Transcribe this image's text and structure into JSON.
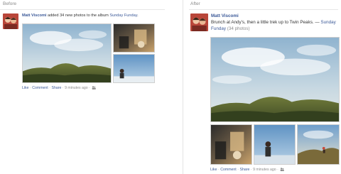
{
  "before": {
    "label": "Before",
    "actor": "Matt Viscomi",
    "story_text": " added 34 new photos to the album ",
    "album": "Sunday Funday",
    "story_end": ".",
    "actions": {
      "like": "Like",
      "comment": "Comment",
      "share": "Share",
      "time": "9 minutes ago",
      "separator": "·"
    }
  },
  "after": {
    "label": "After",
    "actor": "Matt Viscomi",
    "caption": "Brunch at Andy's, then a little trek up to Twin Peaks.",
    "dash": " — ",
    "album": "Sunday Funday",
    "count": "(34 photos)",
    "actions": {
      "like": "Like",
      "comment": "Comment",
      "share": "Share",
      "time": "9 minutes ago",
      "separator": "·"
    }
  },
  "icons": {
    "audience": "people-icon",
    "avatar": "profile-photo"
  },
  "colors": {
    "link": "#3b5998",
    "muted": "#8a8a8a",
    "text": "#333333",
    "divider": "#e3e3e3"
  }
}
